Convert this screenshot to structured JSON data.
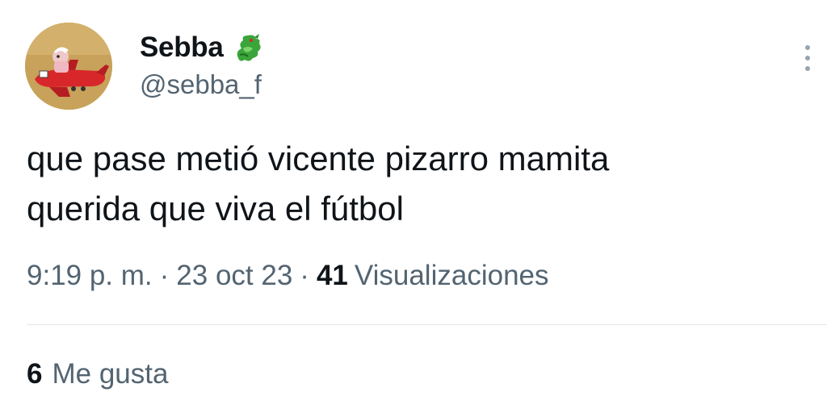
{
  "author": {
    "display_name": "Sebba",
    "emoji_icon": "dragon-icon",
    "handle": "@sebba_f",
    "avatar_icon": "cartoon-airplane-avatar"
  },
  "tweet": {
    "text": "que pase metió vicente pizarro mamita\nquerida que viva el fútbol"
  },
  "meta": {
    "time": "9:19 p. m.",
    "separator": "·",
    "date": "23 oct 23",
    "views_count": "41",
    "views_label": "Visualizaciones"
  },
  "stats": {
    "likes_count": "6",
    "likes_label": "Me gusta"
  },
  "menu": {
    "icon": "more-vertical-icon"
  },
  "colors": {
    "text_primary": "#0f1419",
    "text_secondary": "#536471",
    "divider": "#e3e7ea",
    "background": "#ffffff"
  }
}
